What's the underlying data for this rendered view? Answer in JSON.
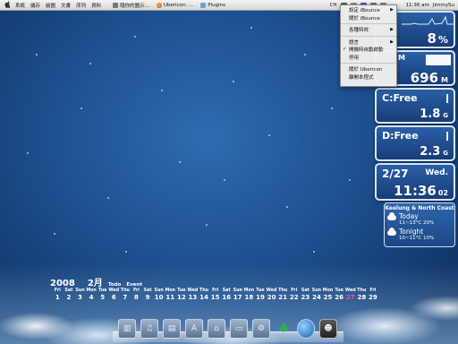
{
  "menubar": {
    "apple": "",
    "menus": [
      "系統",
      "儲存",
      "繪圖",
      "文書",
      "序列",
      "資料"
    ],
    "docs": [
      {
        "label": "隨你的圖示...",
        "icon": "document-icon"
      },
      {
        "label": "Ubericon: ...",
        "icon": "firefox-icon"
      },
      {
        "label": "Plugins",
        "icon": "folder-icon"
      }
    ],
    "input_method": "CH",
    "clock": "11:36 am",
    "user": "JimmySu"
  },
  "dropdown": {
    "items": [
      {
        "label": "設定 iBounce",
        "submenu": true
      },
      {
        "label": "關於 iBounce",
        "submenu": false
      },
      {
        "sep": true
      },
      {
        "label": "各種特效",
        "submenu": true
      },
      {
        "sep": true
      },
      {
        "label": "語言",
        "submenu": true
      },
      {
        "label": "開機時自動啟動",
        "checked": true
      },
      {
        "label": "停用"
      },
      {
        "sep": true
      },
      {
        "label": "關於 Ubericon"
      },
      {
        "label": "離開本程式"
      }
    ]
  },
  "widgets": {
    "cpu": {
      "value": "8",
      "unit": "%",
      "level": 0.08
    },
    "memory": {
      "label": "M",
      "value": "696",
      "unit": "M",
      "level": 0.6
    },
    "disk_c": {
      "label": "C:Free",
      "value": "1.8",
      "unit": "G",
      "level": 0.15
    },
    "disk_d": {
      "label": "D:Free",
      "value": "2.3",
      "unit": "G",
      "level": 0.15
    },
    "date": {
      "date": "2/27",
      "weekday": "Wed.",
      "time": "11:36",
      "seconds": "02"
    }
  },
  "weather": {
    "title": "Keelung & North Coast",
    "rows": [
      {
        "label": "Today",
        "temp": "11~13°C 20%"
      },
      {
        "label": "Tonight",
        "temp": "10~11°C 10%"
      }
    ]
  },
  "calendar": {
    "year": "2008",
    "month": "2月",
    "todo": "Todo",
    "event": "Event",
    "today": 27,
    "days": [
      {
        "dn": "Fri",
        "d": "1"
      },
      {
        "dn": "Sat",
        "d": "2"
      },
      {
        "dn": "Sun",
        "d": "3"
      },
      {
        "dn": "Mon",
        "d": "4"
      },
      {
        "dn": "Tue",
        "d": "5"
      },
      {
        "dn": "Wed",
        "d": "6"
      },
      {
        "dn": "Thu",
        "d": "7"
      },
      {
        "dn": "Fri",
        "d": "8"
      },
      {
        "dn": "Sat",
        "d": "9"
      },
      {
        "dn": "Sun",
        "d": "10"
      },
      {
        "dn": "Mon",
        "d": "11"
      },
      {
        "dn": "Tue",
        "d": "12"
      },
      {
        "dn": "Wed",
        "d": "13"
      },
      {
        "dn": "Thu",
        "d": "14"
      },
      {
        "dn": "Fri",
        "d": "15"
      },
      {
        "dn": "Sat",
        "d": "16"
      },
      {
        "dn": "Sun",
        "d": "17"
      },
      {
        "dn": "Mon",
        "d": "18"
      },
      {
        "dn": "Tue",
        "d": "19"
      },
      {
        "dn": "Wed",
        "d": "20"
      },
      {
        "dn": "Thu",
        "d": "21"
      },
      {
        "dn": "Fri",
        "d": "22"
      },
      {
        "dn": "Sat",
        "d": "23"
      },
      {
        "dn": "Sun",
        "d": "24"
      },
      {
        "dn": "Mon",
        "d": "25"
      },
      {
        "dn": "Tue",
        "d": "26"
      },
      {
        "dn": "Wed",
        "d": "27"
      },
      {
        "dn": "Thu",
        "d": "28"
      },
      {
        "dn": "Fri",
        "d": "29"
      }
    ]
  },
  "dock": {
    "items": [
      {
        "name": "finder-icon",
        "glyph": "▥"
      },
      {
        "name": "music-icon",
        "glyph": "♫"
      },
      {
        "name": "movies-icon",
        "glyph": "▤"
      },
      {
        "name": "applications-icon",
        "glyph": "A"
      },
      {
        "name": "sites-icon",
        "glyph": "⌂"
      },
      {
        "name": "screen-icon",
        "glyph": "▭"
      },
      {
        "name": "utilities-icon",
        "glyph": "⚙"
      },
      {
        "name": "msn-icon",
        "glyph": "♣"
      },
      {
        "name": "globe-icon",
        "glyph": ""
      },
      {
        "name": "robot-icon",
        "glyph": "☻"
      }
    ]
  }
}
